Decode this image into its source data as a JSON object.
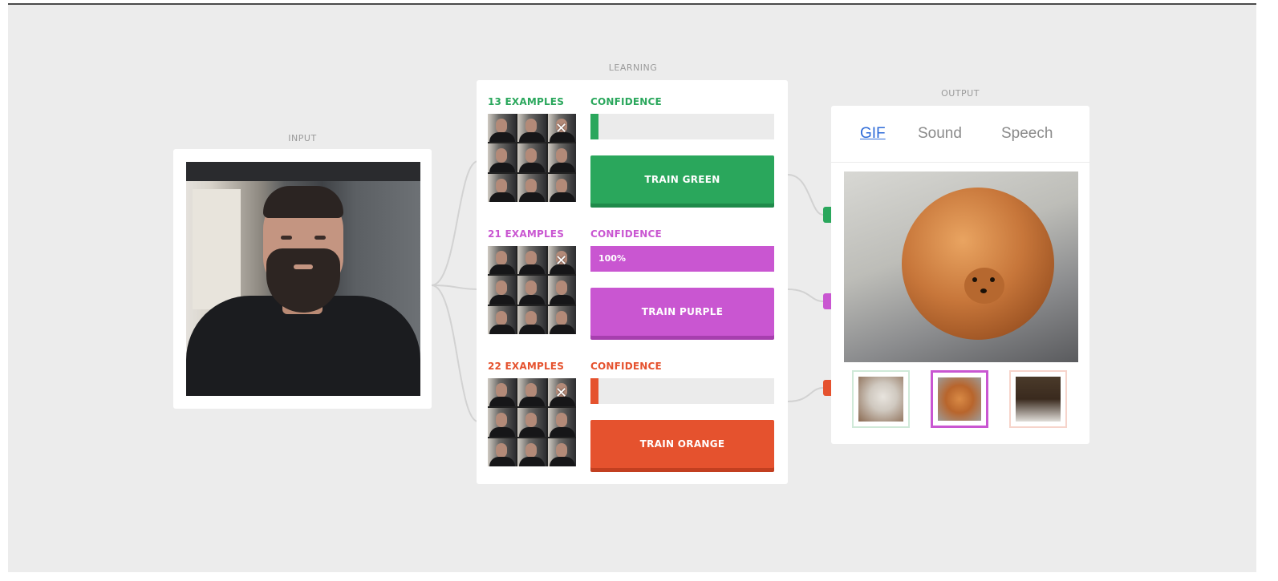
{
  "sections": {
    "input": "INPUT",
    "learning": "LEARNING",
    "output": "OUTPUT"
  },
  "classes": [
    {
      "name": "green",
      "examples": "13 EXAMPLES",
      "confidence_label": "CONFIDENCE",
      "confidence_value": "",
      "confidence_fraction": 0,
      "button": "TRAIN GREEN",
      "color": "#2aa75c",
      "shadow": "#1f8a4a"
    },
    {
      "name": "purple",
      "examples": "21 EXAMPLES",
      "confidence_label": "CONFIDENCE",
      "confidence_value": "100%",
      "confidence_fraction": 1,
      "button": "TRAIN PURPLE",
      "color": "#c956d1",
      "shadow": "#a63fae"
    },
    {
      "name": "orange",
      "examples": "22 EXAMPLES",
      "confidence_label": "CONFIDENCE",
      "confidence_value": "",
      "confidence_fraction": 0,
      "button": "TRAIN ORANGE",
      "color": "#e5522e",
      "shadow": "#c23f20"
    }
  ],
  "output": {
    "tabs": [
      "GIF",
      "Sound",
      "Speech"
    ],
    "active_tab": "GIF",
    "selected_thumb": 1
  },
  "icons": {
    "close": "close-icon"
  }
}
